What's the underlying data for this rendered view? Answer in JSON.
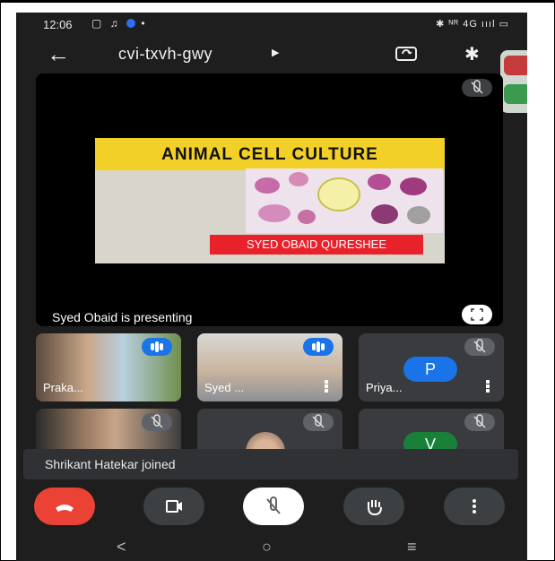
{
  "status_bar": {
    "time": "12:06",
    "right_icons": "✱ ᴺᴿ 4G ıııl ▭"
  },
  "topbar": {
    "meeting_code": "cvi-txvh-gwy"
  },
  "presenter": {
    "slide_title": "ANIMAL CELL CULTURE",
    "slide_name": "SYED OBAID QURESHEE",
    "presenting_text": "Syed Obaid is presenting"
  },
  "tiles": [
    {
      "name": "Praka...",
      "state": "speaking"
    },
    {
      "name": "Syed ...",
      "state": "speaking"
    },
    {
      "name": "Priya...",
      "initial": "P",
      "state": "muted",
      "avatar_color": "#1a73e8"
    },
    {
      "name": "",
      "state": "muted"
    },
    {
      "name": "",
      "state": "muted"
    },
    {
      "name": "",
      "initial": "V",
      "state": "muted",
      "avatar_color": "#188038"
    }
  ],
  "toast": {
    "text": "Shrikant Hatekar joined"
  },
  "colors": {
    "end_call": "#ea4335",
    "accent": "#1a73e8"
  },
  "nav": {
    "back": "<",
    "home": "○",
    "recents": "≡"
  }
}
